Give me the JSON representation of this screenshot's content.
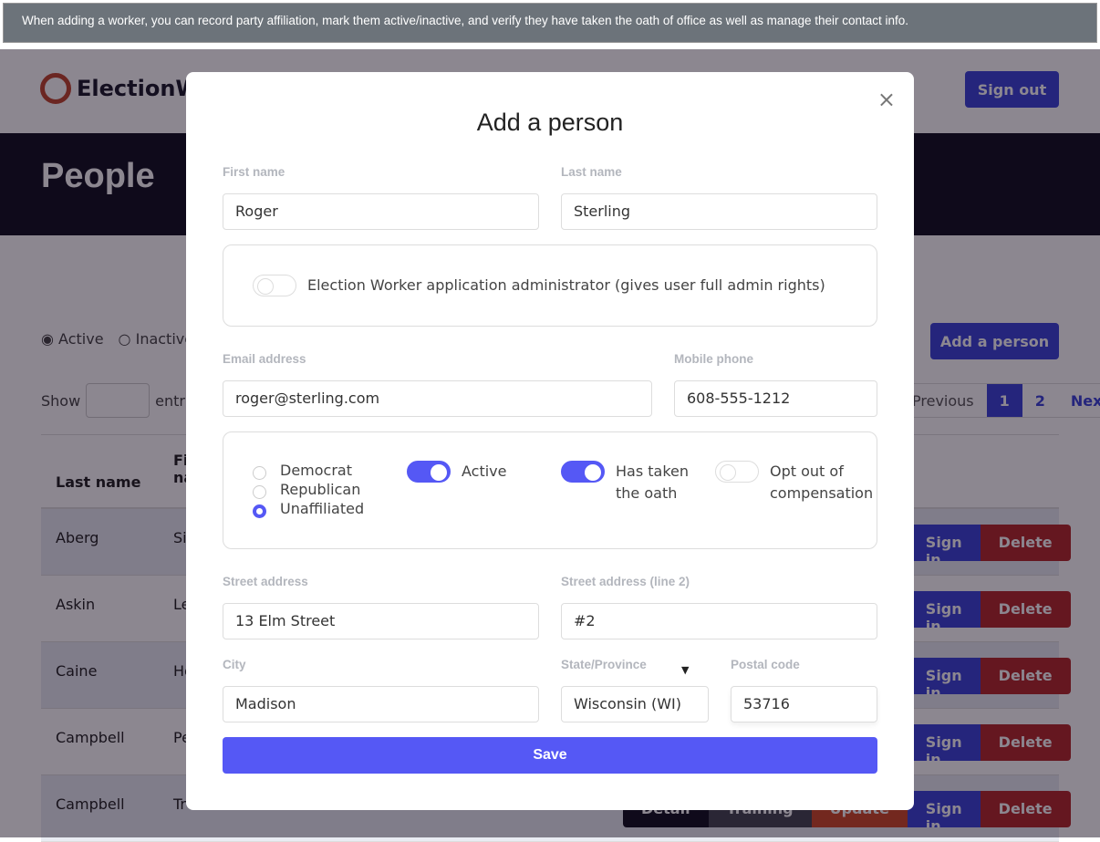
{
  "caption": "When adding a worker, you can record party affiliation, mark them active/inactive, and verify they have taken the oath of office as well as manage their contact info.",
  "page": {
    "brand": "ElectionWorker",
    "sign_out": "Sign out",
    "title": "People",
    "filter_active": "Active",
    "filter_inactive": "Inactive",
    "add_person": "Add a person",
    "show": "Show",
    "entries": "entries",
    "pager": {
      "prev": "Previous",
      "p1": "1",
      "p2": "2",
      "next": "Next"
    },
    "columns": {
      "last": "Last name",
      "first": "First name"
    },
    "rows": [
      {
        "last": "Aberg",
        "first": "Si"
      },
      {
        "last": "Askin",
        "first": "Le"
      },
      {
        "last": "Caine",
        "first": "Ho"
      },
      {
        "last": "Campbell",
        "first": "Pe"
      },
      {
        "last": "Campbell",
        "first": "Tr"
      }
    ],
    "actions": {
      "detail": "Detail",
      "training": "Training",
      "update": "Update",
      "signin": "Sign in",
      "delete": "Delete"
    }
  },
  "modal": {
    "title": "Add a person",
    "first_label": "First name",
    "first": "Roger",
    "last_label": "Last name",
    "last": "Sterling",
    "admin_label": "Election Worker application administrator (gives user full admin rights)",
    "admin_on": false,
    "email_label": "Email address",
    "email": "roger@sterling.com",
    "phone_label": "Mobile phone",
    "phone": "608-555-1212",
    "party": [
      "Democrat",
      "Republican",
      "Unaffiliated"
    ],
    "party_selected": "Unaffiliated",
    "active_label": "Active",
    "active_on": true,
    "oath_label1": "Has taken",
    "oath_label2": "the oath",
    "oath_on": true,
    "opt_label1": "Opt out of",
    "opt_label2": "compensation",
    "opt_on": false,
    "street_label": "Street address",
    "street": "13 Elm Street",
    "street2_label": "Street address (line 2)",
    "street2": "#2",
    "city_label": "City",
    "city": "Madison",
    "state_label": "State/Province",
    "state": "Wisconsin (WI)",
    "postal_label": "Postal code",
    "postal": "53716",
    "save": "Save"
  },
  "colors": {
    "accent": "#5558f5",
    "primary": "#3a44d9",
    "danger": "#b52a2a",
    "hero": "#11101f"
  }
}
